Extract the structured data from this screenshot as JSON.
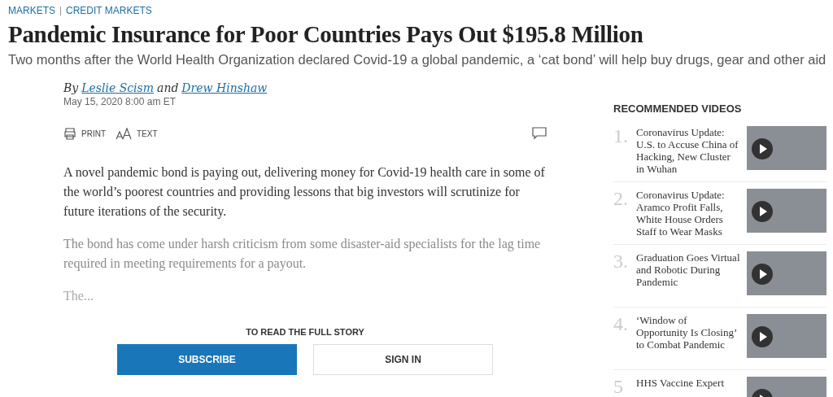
{
  "breadcrumb": [
    "MARKETS",
    "CREDIT MARKETS"
  ],
  "headline": "Pandemic Insurance for Poor Countries Pays Out $195.8 Million",
  "dek": "Two months after the World Health Organization declared Covid-19 a global pandemic, a ‘cat bond’ will help buy drugs, gear and other aid",
  "byline": {
    "prefix": "By",
    "authors": [
      "Leslie Scism",
      "Drew Hinshaw"
    ],
    "joiner": "and"
  },
  "date": "May 15, 2020 8:00 am ET",
  "tools": [
    {
      "kind": "print",
      "label": "PRINT"
    },
    {
      "kind": "text",
      "label": "TEXT"
    }
  ],
  "paragraphs": [
    {
      "kind": "body",
      "text": "A novel pandemic bond is paying out, delivering money for Covid-19 health care in some of the world’s poorest countries and providing lessons that big investors will scrutinize for future iterations of the security."
    },
    {
      "kind": "faded",
      "text": "The bond has come under harsh criticism from some disaster-aid specialists for the lag time required in meeting requirements for a payout."
    },
    {
      "kind": "teaser",
      "text": "The..."
    }
  ],
  "paywall": {
    "prompt": "TO READ THE FULL STORY",
    "buttons": [
      {
        "kind": "primary",
        "label": "SUBSCRIBE"
      },
      {
        "kind": "secondary",
        "label": "SIGN IN"
      }
    ]
  },
  "recommended": {
    "title": "RECOMMENDED VIDEOS",
    "items": [
      {
        "number": "1.",
        "title": "Coronavirus Update: U.S. to Accuse China of Hacking, New Cluster in Wuhan"
      },
      {
        "number": "2.",
        "title": "Coronavirus Update: Aramco Profit Falls, White House Orders Staff to Wear Masks"
      },
      {
        "number": "3.",
        "title": "Graduation Goes Virtual and Robotic During Pandemic"
      },
      {
        "number": "4.",
        "title": "‘Window of Opportunity Is Closing’ to Combat Pandemic"
      },
      {
        "number": "5",
        "title": "HHS Vaccine Expert"
      }
    ]
  }
}
